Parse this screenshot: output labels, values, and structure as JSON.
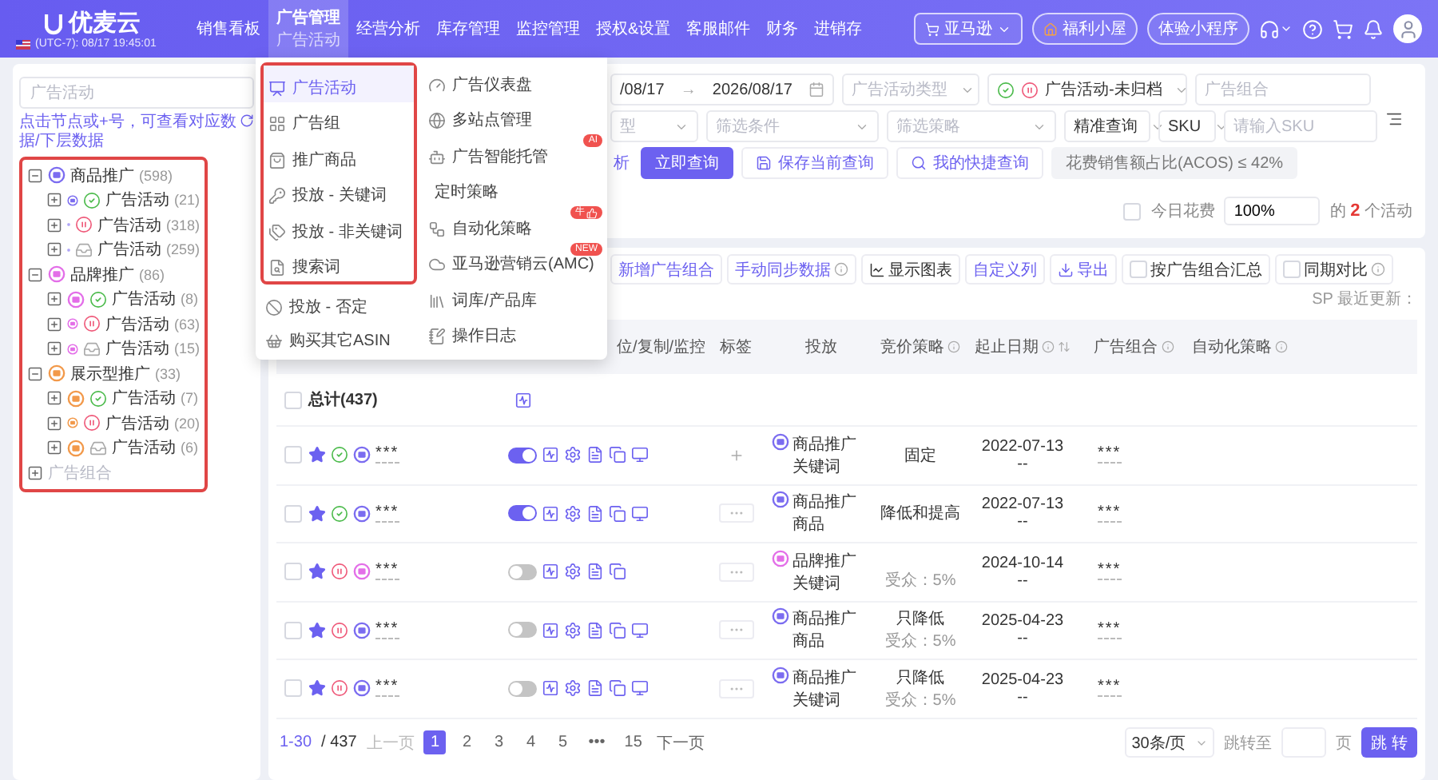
{
  "nav": {
    "logo": "优麦云",
    "clock": "(UTC-7): 08/17 19:45:01",
    "menu": [
      {
        "label": "销售看板",
        "selected": false
      },
      {
        "label": "广告管理",
        "selected": true,
        "sub": "广告活动"
      },
      {
        "label": "经营分析",
        "selected": false
      },
      {
        "label": "库存管理",
        "selected": false
      },
      {
        "label": "监控管理",
        "selected": false
      },
      {
        "label": "授权&设置",
        "selected": false
      },
      {
        "label": "客服邮件",
        "selected": false
      },
      {
        "label": "财务",
        "selected": false
      },
      {
        "label": "进销存",
        "selected": false
      }
    ],
    "marketplace": "亚马逊",
    "perks": "福利小屋",
    "miniapp": "体验小程序"
  },
  "ad_menu": {
    "left_highlighted": [
      {
        "label": "广告活动",
        "selected": true
      },
      {
        "label": "广告组",
        "selected": false
      },
      {
        "label": "推广商品",
        "selected": false
      },
      {
        "label": "投放 - 关键词",
        "selected": false
      },
      {
        "label": "投放 - 非关键词",
        "selected": false
      },
      {
        "label": "搜索词",
        "selected": false
      }
    ],
    "left": [
      {
        "label": "投放 - 否定",
        "selected": false
      },
      {
        "label": "购买其它ASIN",
        "selected": false
      }
    ],
    "right": [
      {
        "label": "广告仪表盘",
        "selected": false
      },
      {
        "label": "多站点管理",
        "selected": false
      },
      {
        "label": "广告智能托管",
        "selected": false,
        "badge": "AI"
      },
      {
        "label": "定时策略",
        "selected": false
      },
      {
        "label": "自动化策略",
        "selected": false,
        "badge": "牛"
      },
      {
        "label": "亚马逊营销云(AMC)",
        "selected": false,
        "badge": "NEW"
      },
      {
        "label": "词库/产品库",
        "selected": false
      },
      {
        "label": "操作日志",
        "selected": false
      }
    ]
  },
  "side": {
    "search_placeholder": "广告活动",
    "hint": "点击节点或+号，可查看对应数据/下层数据",
    "tree": [
      {
        "label": "商品推广",
        "count": "(598)",
        "color": "#7b6cf0",
        "expanded": true,
        "children": [
          {
            "label": "广告活动",
            "count": "(21)",
            "kind": "running",
            "expanded": false
          },
          {
            "label": "广告活动",
            "count": "(318)",
            "kind": "paused",
            "expanded": false
          },
          {
            "label": "广告活动",
            "count": "(259)",
            "kind": "archived",
            "expanded": false
          }
        ]
      },
      {
        "label": "品牌推广",
        "count": "(86)",
        "color": "#e36ee8",
        "expanded": true,
        "children": [
          {
            "label": "广告活动",
            "count": "(8)",
            "kind": "running",
            "expanded": false
          },
          {
            "label": "广告活动",
            "count": "(63)",
            "kind": "paused",
            "expanded": false
          },
          {
            "label": "广告活动",
            "count": "(15)",
            "kind": "archived",
            "expanded": false
          }
        ]
      },
      {
        "label": "展示型推广",
        "count": "(33)",
        "color": "#f2994a",
        "expanded": true,
        "children": [
          {
            "label": "广告活动",
            "count": "(7)",
            "kind": "running",
            "expanded": false
          },
          {
            "label": "广告活动",
            "count": "(20)",
            "kind": "paused",
            "expanded": false
          },
          {
            "label": "广告活动",
            "count": "(6)",
            "kind": "archived",
            "expanded": false
          }
        ]
      },
      {
        "label": "广告组合",
        "expanded": false,
        "muted": true
      }
    ]
  },
  "filters": [
    [
      {
        "kind": "date",
        "start": "/08/17",
        "separator": "→",
        "end": "2026/08/17"
      },
      {
        "kind": "select",
        "placeholder": "广告活动类型"
      },
      {
        "kind": "status-select",
        "value": "广告活动-未归档"
      },
      {
        "kind": "input",
        "placeholder": "广告组合"
      }
    ],
    [
      {
        "kind": "select",
        "placeholder": "型"
      },
      {
        "kind": "select",
        "placeholder": "筛选条件"
      },
      {
        "kind": "select",
        "placeholder": "筛选策略"
      },
      {
        "kind": "select",
        "value": "精准查询"
      },
      {
        "kind": "select",
        "value": "SKU"
      },
      {
        "kind": "input",
        "placeholder": "请输入SKU"
      },
      {
        "kind": "icon-button"
      }
    ],
    [
      {
        "kind": "link",
        "label": "析"
      },
      {
        "kind": "primary",
        "label": "立即查询"
      },
      {
        "kind": "save",
        "label": "保存当前查询"
      },
      {
        "kind": "quick",
        "label": "我的快捷查询"
      },
      {
        "kind": "chip",
        "label": "花费销售额占比(ACOS) ≤ 42%"
      }
    ]
  ],
  "summary": {
    "today_spend": {
      "label": "今日花费",
      "checked": false
    },
    "percent": "100%",
    "count_text": "的 **2** 个活动"
  },
  "toolbar": [
    {
      "kind": "outline",
      "label": "新增广告组合"
    },
    {
      "kind": "outline",
      "label": "手动同步数据",
      "info": true
    },
    {
      "kind": "chart",
      "label": "显示图表"
    },
    {
      "kind": "outline",
      "label": "自定义列"
    },
    {
      "kind": "export",
      "label": "导出"
    },
    {
      "kind": "checkbox",
      "label": "按广告组合汇总",
      "checked": false
    },
    {
      "kind": "checkbox",
      "label": "同期对比",
      "checked": false,
      "info": true
    },
    {
      "kind": "text",
      "label": "SP 最近更新："
    }
  ],
  "table": {
    "columns": [
      {
        "label": "位/复制/监控"
      },
      {
        "label": "标签"
      },
      {
        "label": "投放"
      },
      {
        "label": "竞价策略",
        "info": true
      },
      {
        "label": "起止日期",
        "info": true,
        "sortable": true
      },
      {
        "label": "广告组合",
        "info": true
      },
      {
        "label": "自动化策略",
        "info": true
      }
    ],
    "total": {
      "label": "总计(437)",
      "checked": false
    },
    "rows": [
      {
        "selected": false,
        "starred": true,
        "kind": "running",
        "color": "#7b6cf0",
        "name": "***",
        "enabled": true,
        "monitor": true,
        "has_tags": false,
        "targeting": [
          "商品推广",
          "关键词"
        ],
        "bid": "固定",
        "start": "2022-07-13",
        "end": "--",
        "portfolio": "***"
      },
      {
        "selected": false,
        "starred": true,
        "kind": "running",
        "color": "#7b6cf0",
        "name": "***",
        "enabled": true,
        "monitor": true,
        "has_tags": true,
        "targeting": [
          "商品推广",
          "商品"
        ],
        "bid": "降低和提高",
        "start": "2022-07-13",
        "end": "--",
        "portfolio": "***"
      },
      {
        "selected": false,
        "starred": true,
        "kind": "paused",
        "color": "#e36ee8",
        "name": "***",
        "enabled": false,
        "monitor": false,
        "has_tags": true,
        "targeting": [
          "品牌推广",
          "关键词"
        ],
        "audience": "受众：5%",
        "start": "2024-10-14",
        "end": "--",
        "portfolio": "***"
      },
      {
        "selected": false,
        "starred": true,
        "kind": "paused",
        "color": "#7b6cf0",
        "name": "***",
        "enabled": false,
        "monitor": true,
        "has_tags": true,
        "targeting": [
          "商品推广",
          "商品"
        ],
        "bid": "只降低",
        "audience": "受众：5%",
        "start": "2025-04-23",
        "end": "--",
        "portfolio": "***"
      },
      {
        "selected": false,
        "starred": true,
        "kind": "paused",
        "color": "#7b6cf0",
        "name": "***",
        "enabled": false,
        "monitor": true,
        "has_tags": true,
        "targeting": [
          "商品推广",
          "关键词"
        ],
        "bid": "只降低",
        "audience": "受众：5%",
        "start": "2025-04-23",
        "end": "--",
        "portfolio": "***"
      }
    ]
  },
  "pagination": {
    "range": "1-30",
    "total": "/ 437",
    "prev": "上一页",
    "pages": [
      {
        "label": "1",
        "selected": true
      },
      {
        "label": "2",
        "selected": false
      },
      {
        "label": "3",
        "selected": false
      },
      {
        "label": "4",
        "selected": false
      },
      {
        "label": "5",
        "selected": false
      },
      {
        "label": "•••",
        "selected": false
      },
      {
        "label": "15",
        "selected": false
      }
    ],
    "next": "下一页",
    "page_size": "30条/页",
    "jump_label": "跳转至",
    "page_unit": "页",
    "go": "跳 转"
  }
}
